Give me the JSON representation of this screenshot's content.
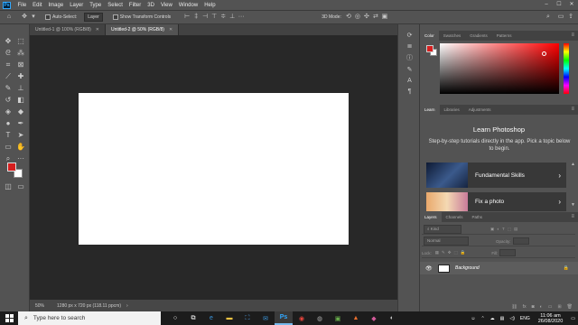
{
  "menubar": {
    "logo": "Ps",
    "items": [
      "File",
      "Edit",
      "Image",
      "Layer",
      "Type",
      "Select",
      "Filter",
      "3D",
      "View",
      "Window",
      "Help"
    ],
    "window_controls": [
      "–",
      "☐",
      "✕"
    ]
  },
  "options_bar": {
    "auto_select_label": "Auto-Select:",
    "auto_select_value": "Layer",
    "show_transform_label": "Show Transform Controls",
    "mode_3d_label": "3D Mode:"
  },
  "document_tabs": [
    {
      "label": "Untitled-1 @ 100% (RGB/8)",
      "active": false
    },
    {
      "label": "Untitled-2 @ 50% (RGB/8)",
      "active": true
    }
  ],
  "status_bar": {
    "zoom": "50%",
    "doc_info": "1280 px x 720 px (118.11 ppcm)"
  },
  "color_panel": {
    "tabs": [
      "Color",
      "Swatches",
      "Gradients",
      "Patterns"
    ],
    "foreground_color": "#d61f1f",
    "background_color": "#ffffff"
  },
  "learn_panel": {
    "tabs": [
      "Learn",
      "Libraries",
      "Adjustments"
    ],
    "title": "Learn Photoshop",
    "description": "Step-by-step tutorials directly in the app. Pick a topic below to begin.",
    "cards": [
      {
        "label": "Fundamental Skills"
      },
      {
        "label": "Fix a photo"
      }
    ]
  },
  "layers_panel": {
    "tabs": [
      "Layers",
      "Channels",
      "Paths"
    ],
    "filter_kind": "Kind",
    "blend_mode": "Normal",
    "opacity_label": "Opacity:",
    "lock_label": "Lock:",
    "fill_label": "Fill:",
    "layer_name": "Background"
  },
  "taskbar": {
    "search_placeholder": "Type here to search",
    "language": "ENG",
    "time": "11:06 am",
    "date": "26/08/2020"
  }
}
